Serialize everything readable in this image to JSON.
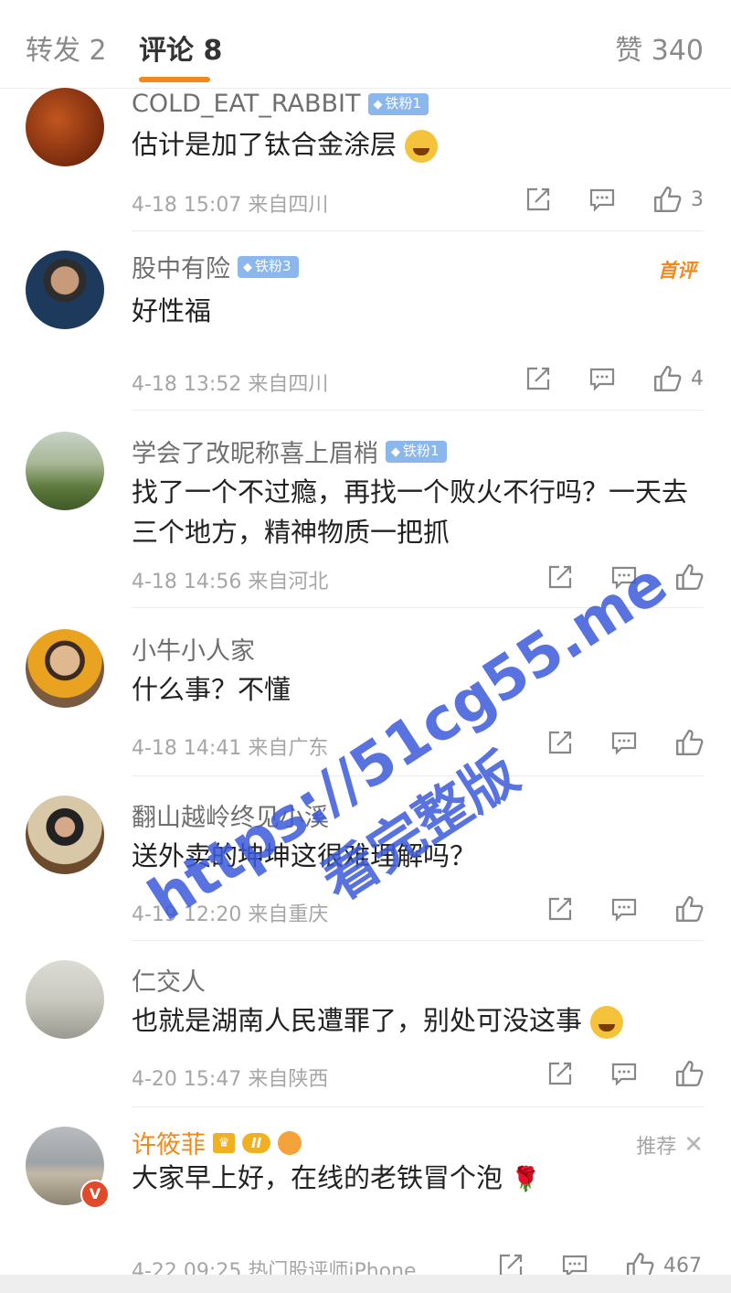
{
  "tabs": {
    "repost": "转发 2",
    "comments": "评论 8",
    "likes": "赞 340"
  },
  "colors": {
    "accent": "#f08a1c",
    "badge": "#8bb7ec",
    "watermark": "#3b5bdb"
  },
  "comments": [
    {
      "user": "COLD_EAT_RABBIT",
      "badge": "铁粉1",
      "text": "估计是加了钛合金涂层",
      "time": "4-18 15:07",
      "source": "来自四川",
      "likes": "3",
      "emoji": "laughing"
    },
    {
      "user": "股中有险",
      "badge": "铁粉3",
      "text": "好性福",
      "time": "4-18 13:52",
      "source": "来自四川",
      "likes": "4",
      "tag": "首评"
    },
    {
      "user": "学会了改昵称喜上眉梢",
      "badge": "铁粉1",
      "text": "找了一个不过瘾，再找一个败火不行吗？一天去三个地方，精神物质一把抓",
      "time": "4-18 14:56",
      "source": "来自河北",
      "likes": ""
    },
    {
      "user": "小牛小人家",
      "text": "什么事？不懂",
      "time": "4-18 14:41",
      "source": "来自广东",
      "likes": ""
    },
    {
      "user": "翻山越岭终见小溪",
      "text": "送外卖的坤坤这很难理解吗？",
      "time": "4-19 12:20",
      "source": "来自重庆",
      "likes": ""
    },
    {
      "user": "仁交人",
      "text": "也就是湖南人民遭罪了，别处可没这事",
      "time": "4-20 15:47",
      "source": "来自陕西",
      "likes": "",
      "emoji": "grin"
    },
    {
      "user": "许筱菲",
      "text": "大家早上好，在线的老铁冒个泡",
      "time": "4-22 09:25",
      "source": "热门股评师iPhone",
      "likes": "467",
      "tag": "推荐",
      "vip_level": "II"
    }
  ],
  "watermark": {
    "url": "https://51cg55.me",
    "sub": "看完整版"
  }
}
